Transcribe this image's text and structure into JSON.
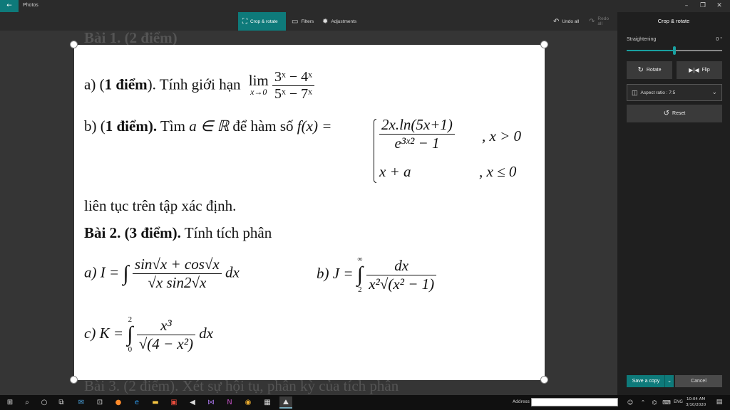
{
  "app": {
    "title": "Photos"
  },
  "toolbar": {
    "crop_rotate": "Crop & rotate",
    "filters": "Filters",
    "adjustments": "Adjustments",
    "undo_all": "Undo all",
    "redo_all": "Redo all"
  },
  "panel": {
    "title": "Crop & rotate",
    "straightening_label": "Straightening",
    "straightening_value": "0 °",
    "straightening_fraction": 0.5,
    "rotate": "Rotate",
    "flip": "Flip",
    "aspect_ratio": "Aspect ratio : 7:5",
    "reset": "Reset",
    "save_copy": "Save a copy",
    "cancel": "Cancel"
  },
  "document": {
    "top_cut": "Bài 1. (2 điểm)",
    "a_prefix": "a) (",
    "a_bold": "1 điểm",
    "a_text": "). Tính giới hạn",
    "lim": "lim",
    "lim_sub": "x→0",
    "a_num": "3ˣ − 4ˣ",
    "a_den": "5ˣ − 7ˣ",
    "b_prefix": "b) (",
    "b_bold": "1 điểm).",
    "b_text": " Tìm ",
    "b_a": "a ∈ ℝ",
    "b_text2": " để hàm số ",
    "b_f": "f(x) =",
    "b_case1_num": "2x.ln(5x+1)",
    "b_case1_den": "e³ˣ² − 1",
    "b_case1_cond": ", x > 0",
    "b_case2": "x + a",
    "b_case2_cond": ", x ≤ 0",
    "cont": "liên tục trên tập xác định.",
    "bai2_bold": "Bài 2. (3 điểm).",
    "bai2_text": " Tính tích phân",
    "ia_label": "a) I =",
    "ia_num": "sin√x + cos√x",
    "ia_den": "√x sin2√x",
    "ia_dx": "dx",
    "ib_label": "b) J =",
    "ib_upper": "∞",
    "ib_lower": "2",
    "ib_num": "dx",
    "ib_den": "x²√(x² − 1)",
    "ic_label": "c) K =",
    "ic_upper": "2",
    "ic_lower": "0",
    "ic_num": "x³",
    "ic_den": "√(4 − x²)",
    "ic_dx": "dx",
    "bottom_cut": "Bài 3. (2 điểm). Xét sự hội tụ, phân kỳ của tích phân"
  },
  "taskbar": {
    "address_label": "Address",
    "lang": "ENG",
    "time": "10:04 AM",
    "date": "3/10/2020"
  }
}
